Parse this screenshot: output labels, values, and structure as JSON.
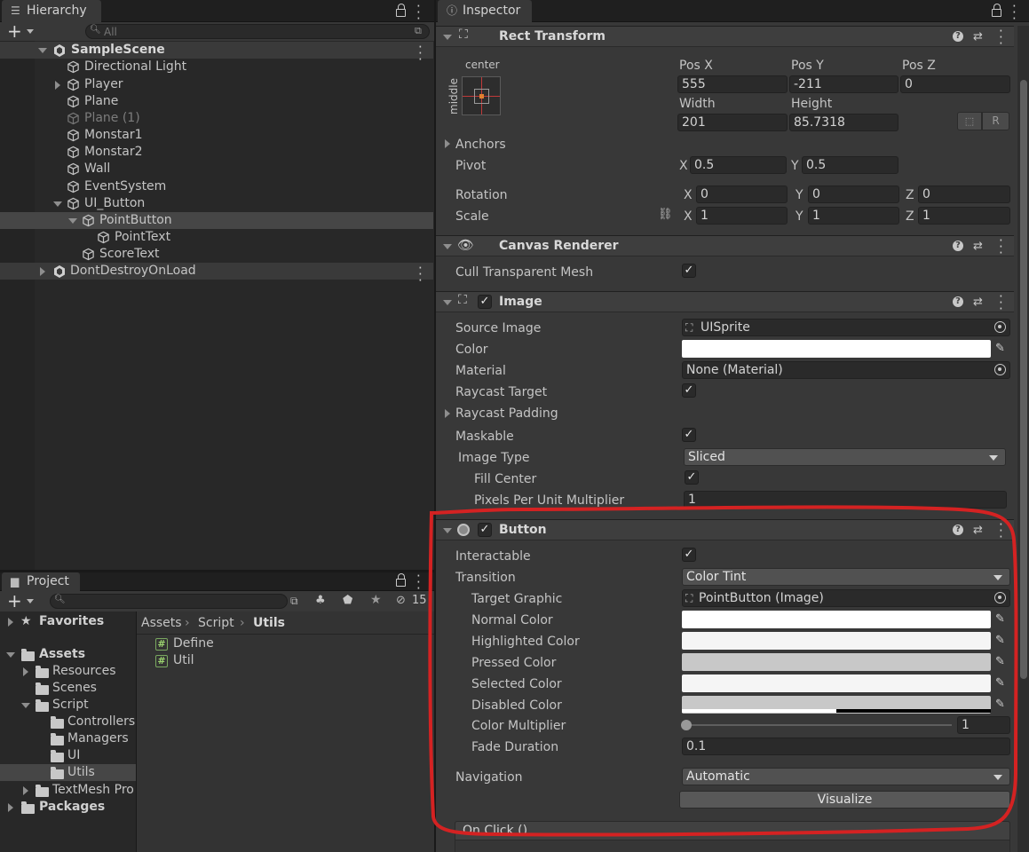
{
  "hierarchy": {
    "tab_label": "Hierarchy",
    "search_placeholder": "All",
    "items": [
      {
        "label": "SampleScene"
      },
      {
        "label": "Directional Light"
      },
      {
        "label": "Player"
      },
      {
        "label": "Plane"
      },
      {
        "label": "Plane (1)"
      },
      {
        "label": "Monstar1"
      },
      {
        "label": "Monstar2"
      },
      {
        "label": "Wall"
      },
      {
        "label": "EventSystem"
      },
      {
        "label": "UI_Button"
      },
      {
        "label": "PointButton"
      },
      {
        "label": "PointText"
      },
      {
        "label": "ScoreText"
      },
      {
        "label": "DontDestroyOnLoad"
      }
    ]
  },
  "project": {
    "tab_label": "Project",
    "hidden_count": "15",
    "tree": [
      {
        "label": "Favorites"
      },
      {
        "label": "Assets"
      },
      {
        "label": "Resources"
      },
      {
        "label": "Scenes"
      },
      {
        "label": "Script"
      },
      {
        "label": "Controllers"
      },
      {
        "label": "Managers"
      },
      {
        "label": "UI"
      },
      {
        "label": "Utils"
      },
      {
        "label": "TextMesh Pro"
      },
      {
        "label": "Packages"
      }
    ],
    "breadcrumb": [
      "Assets",
      "Script",
      "Utils"
    ],
    "files": [
      {
        "label": "Define"
      },
      {
        "label": "Util"
      }
    ]
  },
  "inspector": {
    "tab_label": "Inspector",
    "rect_transform": {
      "title": "Rect Transform",
      "anchor_h": "center",
      "anchor_v": "middle",
      "pos_x_label": "Pos X",
      "pos_x": "555",
      "pos_y_label": "Pos Y",
      "pos_y": "-211",
      "pos_z_label": "Pos Z",
      "pos_z": "0",
      "width_label": "Width",
      "width": "201",
      "height_label": "Height",
      "height": "85.7318",
      "r_btn": "R",
      "anchors_label": "Anchors",
      "pivot_label": "Pivot",
      "pivot_x": "0.5",
      "pivot_y": "0.5",
      "rotation_label": "Rotation",
      "rot_x": "0",
      "rot_y": "0",
      "rot_z": "0",
      "scale_label": "Scale",
      "scale_x": "1",
      "scale_y": "1",
      "scale_z": "1",
      "x": "X",
      "y": "Y",
      "z": "Z"
    },
    "canvas_renderer": {
      "title": "Canvas Renderer",
      "cull_label": "Cull Transparent Mesh"
    },
    "image": {
      "title": "Image",
      "source_label": "Source Image",
      "source_value": "UISprite",
      "color_label": "Color",
      "material_label": "Material",
      "material_value": "None (Material)",
      "raycast_label": "Raycast Target",
      "raycast_padding_label": "Raycast Padding",
      "maskable_label": "Maskable",
      "image_type_label": "Image Type",
      "image_type_value": "Sliced",
      "fill_center_label": "Fill Center",
      "ppu_label": "Pixels Per Unit Multiplier",
      "ppu_value": "1"
    },
    "button": {
      "title": "Button",
      "interactable_label": "Interactable",
      "transition_label": "Transition",
      "transition_value": "Color Tint",
      "target_label": "Target Graphic",
      "target_value": "PointButton (Image)",
      "normal_label": "Normal Color",
      "highlighted_label": "Highlighted Color",
      "pressed_label": "Pressed Color",
      "selected_label": "Selected Color",
      "disabled_label": "Disabled Color",
      "multiplier_label": "Color Multiplier",
      "multiplier_value": "1",
      "fade_label": "Fade Duration",
      "fade_value": "0.1",
      "navigation_label": "Navigation",
      "navigation_value": "Automatic",
      "visualize_label": "Visualize",
      "onclick_label": "On Click ()"
    }
  },
  "colors": {
    "annotation": "#d42222",
    "normal": "#ffffff",
    "highlighted": "#f5f5f5",
    "pressed": "#c8c8c8",
    "selected": "#f5f5f5",
    "disabled": "#c8c8c8"
  }
}
